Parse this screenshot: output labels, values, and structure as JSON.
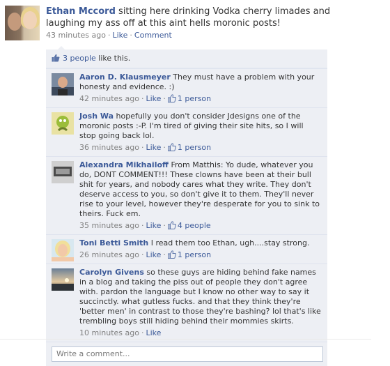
{
  "post": {
    "author": "Ethan Mccord",
    "text": "sitting here drinking Vodka cherry limades and laughing my ass off at this aint hells moronic posts!",
    "time": "43 minutes ago",
    "separator": "·",
    "like_label": "Like",
    "comment_label": "Comment"
  },
  "likes": {
    "count_label": "3 people",
    "suffix": "like this."
  },
  "comments": [
    {
      "author": "Aaron D. Klausmeyer",
      "text": "They must have a problem with your honesty and evidence. :)",
      "time": "42 minutes ago",
      "like_label": "Like",
      "likes_count": "1 person"
    },
    {
      "author": "Josh Wa",
      "text": "hopefully you don't consider Jdesigns one of the moronic posts :-P. I'm tired of giving their site hits, so I will stop going back lol.",
      "time": "36 minutes ago",
      "like_label": "Like",
      "likes_count": "1 person"
    },
    {
      "author": "Alexandra Mikhailoff",
      "text": "From Matthis: Yo dude, whatever you do, DONT COMMENT!!! These clowns have been at their bull shit for years, and nobody cares what they write. They don't deserve access to you, so don't give it to them. They'll never rise to your level, however they're desperate for you to sink to theirs. Fuck em.",
      "time": "35 minutes ago",
      "like_label": "Like",
      "likes_count": "4 people"
    },
    {
      "author": "Toni Betti Smith",
      "text": "I read them too Ethan, ugh....stay strong.",
      "time": "26 minutes ago",
      "like_label": "Like",
      "likes_count": "1 person"
    },
    {
      "author": "Carolyn Givens",
      "text": "so these guys are hiding behind fake names in a blog and taking the piss out of people they don't agree with. pardon the language but I know no other way to say it succinctly. what gutless fucks. and that they think they're 'better men' in contrast to those they're bashing? lol that's like trembling boys still hiding behind their mommies skirts.",
      "time": "10 minutes ago",
      "like_label": "Like",
      "likes_count": ""
    }
  ],
  "composer": {
    "placeholder": "Write a comment..."
  },
  "colors": {
    "link": "#3b5998",
    "feedback_bg": "#edeff4",
    "meta": "#808080"
  },
  "icons": {
    "like": "thumbs-up-icon"
  }
}
